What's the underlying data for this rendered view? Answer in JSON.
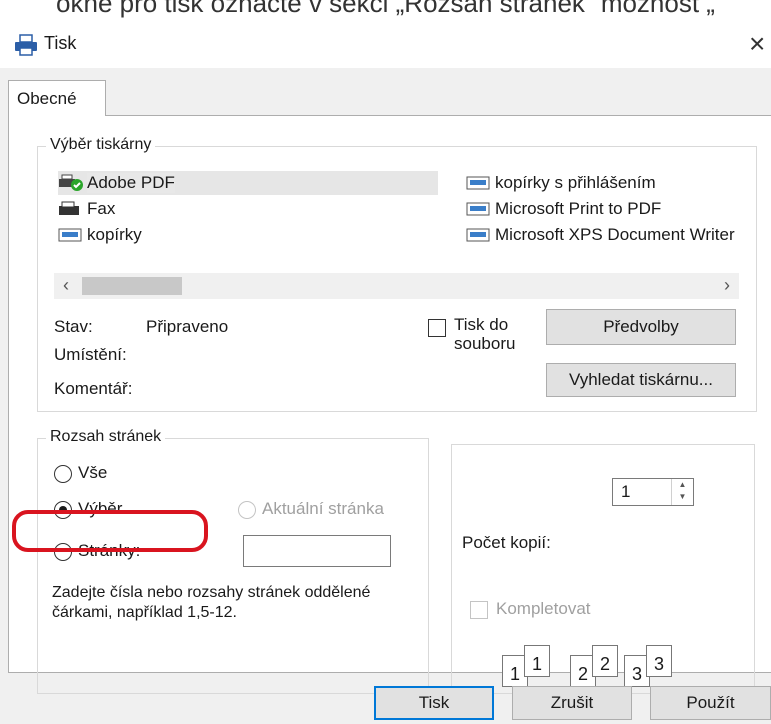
{
  "caption": "okně pro tisk označte v sekci „Rozsah stránek“ možnost „",
  "window": {
    "title": "Tisk",
    "close": "×"
  },
  "tab": {
    "label": "Obecné"
  },
  "printer_group": {
    "legend": "Výběr tiskárny",
    "printers": [
      {
        "name": "Adobe PDF",
        "icon": "printer-default-icon",
        "selected": true
      },
      {
        "name": "Fax",
        "icon": "fax-icon",
        "selected": false
      },
      {
        "name": "kopírky",
        "icon": "printer-icon",
        "selected": false
      },
      {
        "name": "kopírky s přihlášením",
        "icon": "printer-icon",
        "selected": false
      },
      {
        "name": "Microsoft Print to PDF",
        "icon": "printer-icon",
        "selected": false
      },
      {
        "name": "Microsoft XPS Document Writer",
        "icon": "printer-icon",
        "selected": false
      }
    ],
    "status_label": "Stav:",
    "status_value": "Připraveno",
    "location_label": "Umístění:",
    "location_value": "",
    "comment_label": "Komentář:",
    "comment_value": "",
    "print_to_file_label": "Tisk do souboru",
    "print_to_file_checked": false,
    "preferences_button": "Předvolby",
    "find_printer_button": "Vyhledat tiskárnu..."
  },
  "page_range": {
    "legend": "Rozsah stránek",
    "all_label": "Vše",
    "selection_label": "Výběr",
    "current_page_label": "Aktuální stránka",
    "pages_label": "Stránky:",
    "pages_value": "",
    "selected": "selection",
    "hint": "Zadejte čísla nebo rozsahy stránek oddělené čárkami, například 1,5-12."
  },
  "copies": {
    "label": "Počet kopií:",
    "value": "1",
    "collate_label": "Kompletovat",
    "collate_checked": false,
    "collate_pages": [
      "1",
      "1",
      "2",
      "2",
      "3",
      "3"
    ]
  },
  "buttons": {
    "print": "Tisk",
    "cancel": "Zrušit",
    "apply": "Použít"
  },
  "annotation": {
    "color": "#d9141f"
  },
  "colors": {
    "accent": "#0078d7",
    "dialog_bg": "#f0f0f0"
  }
}
